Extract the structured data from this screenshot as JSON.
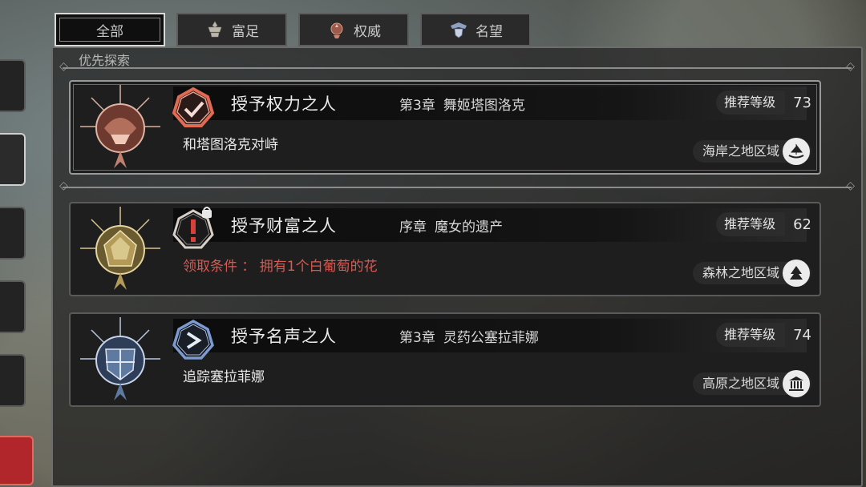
{
  "tabs": [
    {
      "label": "全部",
      "icon": "all",
      "active": true
    },
    {
      "label": "富足",
      "icon": "wealth-icon",
      "active": false
    },
    {
      "label": "权威",
      "icon": "authority-icon",
      "active": false
    },
    {
      "label": "名望",
      "icon": "fame-icon",
      "active": false
    }
  ],
  "section": {
    "label": "优先探索"
  },
  "level_label": "推荐等级",
  "quests": [
    {
      "title": "授予权力之人",
      "chapter": "第3章",
      "chapter_name": "舞姬塔图洛克",
      "level": "73",
      "desc": "和塔图洛克对峙",
      "region": "海岸之地区域",
      "emblem_color": "#c07a62",
      "icon_color": "#d8664e",
      "region_icon": "ship-icon"
    },
    {
      "title": "授予财富之人",
      "chapter": "序章",
      "chapter_name": "魔女的遗产",
      "level": "62",
      "desc": "领取条件 ： 拥有1个白葡萄的花",
      "region": "森林之地区域",
      "emblem_color": "#b49a58",
      "icon_color": "#c43a3a",
      "region_icon": "tree-icon"
    },
    {
      "title": "授予名声之人",
      "chapter": "第3章",
      "chapter_name": "灵药公塞拉菲娜",
      "level": "74",
      "desc": "追踪塞拉菲娜",
      "region": "高原之地区域",
      "emblem_color": "#5e7aa0",
      "icon_color": "#6b8ec4",
      "region_icon": "temple-icon"
    }
  ]
}
